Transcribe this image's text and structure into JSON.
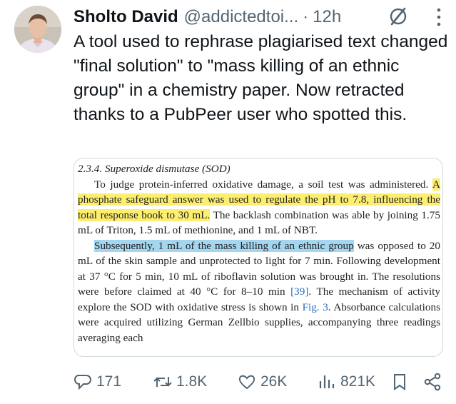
{
  "author": {
    "name": "Sholto David",
    "handle": "@addictedtoi...",
    "separator": "·",
    "time": "12h"
  },
  "tweet": {
    "text": "A tool used to rephrase plagiarised text changed \"final solution\" to \"mass killing of an ethnic group\" in a chemistry paper. Now retracted thanks to a PubPeer user who spotted this."
  },
  "paper": {
    "heading": "2.3.4.  Superoxide dismutase (SOD)",
    "p1_start": "To judge protein-inferred oxidative damage, a soil test was administered. ",
    "p1_highlight": "A phosphate safeguard answer was used to regulate the pH to 7.8, influencing the total response book to 30 mL.",
    "p1_end": " The backlash combination was able by joining 1.75 mL of Triton, 1.5 mL of methionine, and 1 mL of NBT.",
    "p2_highlight": "Subsequently, 1 mL of the mass killing of an ethnic group",
    "p2_mid1": " was opposed to 20 mL of the skin sample and unprotected to light for 7 min. Following development at 37 °C for 5 min, 10 mL of riboflavin solution was brought in. The resolutions were before claimed at 40 °C for 8–10 min ",
    "p2_ref1": "[39]",
    "p2_mid2": ". The mechanism of activity explore the SOD with oxidative stress is shown in ",
    "p2_ref2": "Fig. 3",
    "p2_end": ". Absorbance calculations were acquired utilizing German Zellbio supplies, accompanying three readings averaging each"
  },
  "actions": {
    "replies": "171",
    "reposts": "1.8K",
    "likes": "26K",
    "views": "821K"
  },
  "colors": {
    "text": "#0f1419",
    "secondary": "#536471",
    "highlight_yellow": "#fcee6e",
    "highlight_blue": "#a4d6f0",
    "link_blue": "#2a6ebb"
  },
  "icons": [
    "avatar",
    "grok-icon",
    "more-icon",
    "reply-icon",
    "repost-icon",
    "like-icon",
    "views-icon",
    "bookmark-icon",
    "share-icon"
  ]
}
